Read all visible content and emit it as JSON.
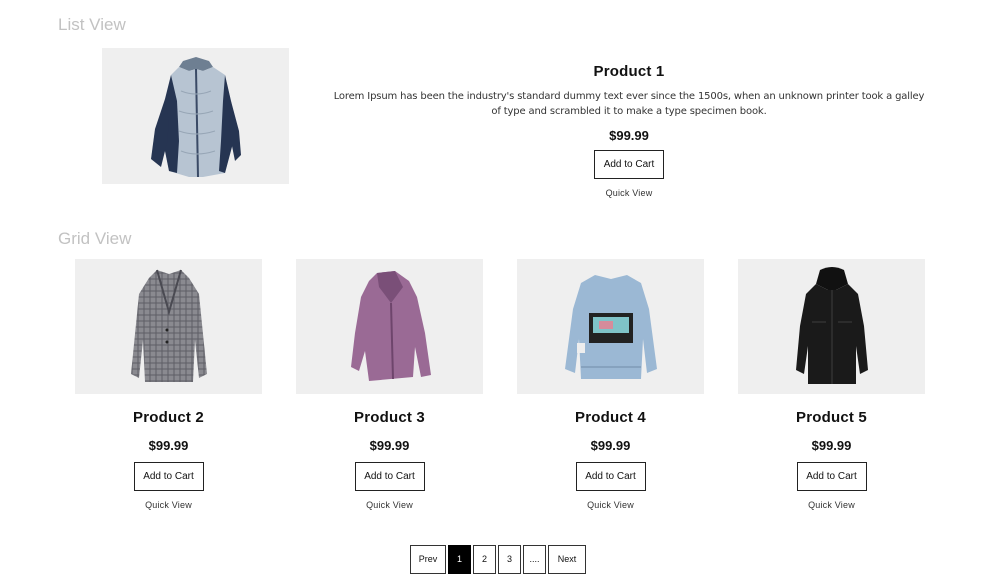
{
  "sections": {
    "list_title": "List View",
    "grid_title": "Grid View"
  },
  "list_item": {
    "name": "Product 1",
    "description": "Lorem Ipsum has been the industry's standard dummy text ever since the 1500s, when an unknown printer took a galley of type and scrambled it to make a type specimen book.",
    "price": "$99.99",
    "cart_label": "Add to Cart",
    "quick_view_label": "Quick View",
    "image_icon": "grey-quilted-jacket-icon"
  },
  "grid_items": [
    {
      "name": "Product 2",
      "price": "$99.99",
      "cart_label": "Add to Cart",
      "quick_view_label": "Quick View",
      "image_icon": "plaid-coat-icon"
    },
    {
      "name": "Product 3",
      "price": "$99.99",
      "cart_label": "Add to Cart",
      "quick_view_label": "Quick View",
      "image_icon": "purple-hoodie-icon"
    },
    {
      "name": "Product 4",
      "price": "$99.99",
      "cart_label": "Add to Cart",
      "quick_view_label": "Quick View",
      "image_icon": "denim-jacket-icon"
    },
    {
      "name": "Product 5",
      "price": "$99.99",
      "cart_label": "Add to Cart",
      "quick_view_label": "Quick View",
      "image_icon": "black-parka-icon"
    }
  ],
  "pagination": {
    "prev": "Prev",
    "pages": [
      "1",
      "2",
      "3"
    ],
    "ellipsis": "....",
    "next": "Next",
    "active_page": "1"
  },
  "colors": {
    "section_title": "#c2c2c2",
    "image_background": "#efefef",
    "active_page_bg": "#000000"
  }
}
